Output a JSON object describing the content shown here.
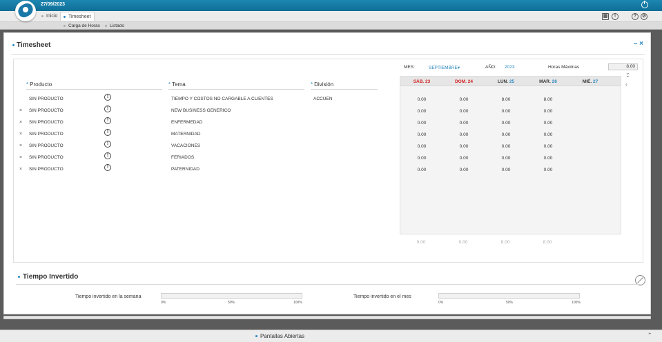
{
  "header": {
    "date": "27/09/2023"
  },
  "breadcrumb": {
    "home": "Inicio",
    "current": "Timesheet"
  },
  "submenu": {
    "item1": "Carga de Horas",
    "item2": "Listado"
  },
  "panel": {
    "title": "Timesheet",
    "minimize": "–",
    "close": "×"
  },
  "filters": {
    "mes_label": "MES:",
    "mes_value": "SEPTIEMBRE",
    "anio_label": "AÑO:",
    "anio_value": "2023",
    "horas_label": "Horas Máximas",
    "horas_value": "8.00"
  },
  "columns": {
    "producto": "Producto",
    "tema": "Tema",
    "division": "División"
  },
  "days": [
    {
      "name": "SÁB.",
      "num": "23",
      "color": "#d0201f",
      "numcolor": "#d0201f"
    },
    {
      "name": "DOM.",
      "num": "24",
      "color": "#d0201f",
      "numcolor": "#d0201f"
    },
    {
      "name": "LUN.",
      "num": "25",
      "color": "#333333",
      "numcolor": "#2a87c0"
    },
    {
      "name": "MAR.",
      "num": "26",
      "color": "#333333",
      "numcolor": "#2a87c0"
    },
    {
      "name": "MIÉ.",
      "num": "27",
      "color": "#333333",
      "numcolor": "#2a87c0"
    }
  ],
  "rows": [
    {
      "x": "",
      "producto": "SIN PRODUCTO",
      "tema": "TIEMPO Y COSTOS NO CARGABLE A CLIENTES",
      "division": "ACCUEN",
      "hours": [
        "0.00",
        "0.00",
        "8.00",
        "8.00"
      ]
    },
    {
      "x": "×",
      "producto": "SIN PRODUCTO",
      "tema": "NEW BUSINESS GENERICO",
      "division": "",
      "hours": [
        "0.00",
        "0.00",
        "0.00",
        "0.00"
      ]
    },
    {
      "x": "×",
      "producto": "SIN PRODUCTO",
      "tema": "ENFERMEDAD",
      "division": "",
      "hours": [
        "0.00",
        "0.00",
        "0.00",
        "0.00"
      ]
    },
    {
      "x": "×",
      "producto": "SIN PRODUCTO",
      "tema": "MATERNIDAD",
      "division": "",
      "hours": [
        "0.00",
        "0.00",
        "0.00",
        "0.00"
      ]
    },
    {
      "x": "×",
      "producto": "SIN PRODUCTO",
      "tema": "VACACIONES",
      "division": "",
      "hours": [
        "0.00",
        "0.00",
        "0.00",
        "0.00"
      ]
    },
    {
      "x": "×",
      "producto": "SIN PRODUCTO",
      "tema": "FERIADOS",
      "division": "",
      "hours": [
        "0.00",
        "0.00",
        "0.00",
        "0.00"
      ]
    },
    {
      "x": "×",
      "producto": "SIN PRODUCTO",
      "tema": "PATERNIDAD",
      "division": "",
      "hours": [
        "0.00",
        "0.00",
        "0.00",
        "0.00"
      ]
    }
  ],
  "totals": [
    "0.00",
    "0.00",
    "8.00",
    "8.00"
  ],
  "tiempo": {
    "title": "Tiempo Invertido",
    "semana_label": "Tiempo invertido en la semana",
    "semana_progress": 0,
    "mes_label": "Tiempo invertido en el mes",
    "mes_progress": 0,
    "ticks": [
      "0%",
      "50%",
      "100%"
    ]
  },
  "footer": {
    "label": "Pantallas Abiertas"
  },
  "colors": {
    "accent": "#2a87c0",
    "weekend": "#d0201f"
  }
}
